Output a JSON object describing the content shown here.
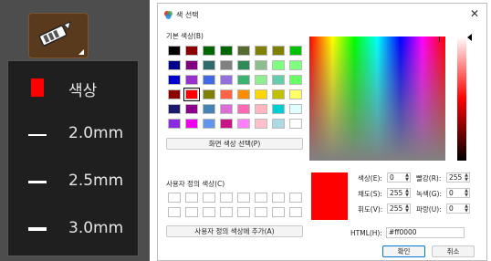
{
  "toolbar": {
    "tool_icon": "highlighter-pen-icon"
  },
  "menu": {
    "items": [
      {
        "label": "색상",
        "kind": "swatch",
        "color": "#ff0000"
      },
      {
        "label": "2.0mm",
        "kind": "line"
      },
      {
        "label": "2.5mm",
        "kind": "line"
      },
      {
        "label": "3.0mm",
        "kind": "line"
      }
    ]
  },
  "dialog": {
    "title": "색 선택",
    "basic_colors_label": "기본 색상(B)",
    "basic_colors": [
      "#000000",
      "#8b0000",
      "#006400",
      "#006400",
      "#556b2f",
      "#808000",
      "#808000",
      "#00c000",
      "#00008b",
      "#800080",
      "#2f6b6b",
      "#808080",
      "#2e8b57",
      "#8fbc8f",
      "#7fff7f",
      "#7fff7f",
      "#0000cd",
      "#9932cc",
      "#4169e1",
      "#9370db",
      "#3cb371",
      "#90ee90",
      "#66cdaa",
      "#66ff66",
      "#8b0000",
      "#ff0000",
      "#808000",
      "#ff6347",
      "#ff8c00",
      "#ffd700",
      "#c0c000",
      "#ffff66",
      "#191970",
      "#8b008b",
      "#4682b4",
      "#da70d6",
      "#ff69b4",
      "#ffb6c1",
      "#00ced1",
      "#e0ffff",
      "#8a2be2",
      "#ee00ee",
      "#6495ed",
      "#c71585",
      "#ff7fff",
      "#ffc0cb",
      "#add8e6",
      "#ffffff"
    ],
    "selected_basic_index": 25,
    "pick_screen_label": "화면 색상 선택(P)",
    "custom_colors_label": "사용자 정의 색상(C)",
    "add_custom_label": "사용자 정의 색상에 추가(A)",
    "fields": {
      "hue_label": "색상(E):",
      "hue": "0",
      "sat_label": "채도(S):",
      "sat": "255",
      "val_label": "휘도(V):",
      "val": "255",
      "red_label": "빨강(R):",
      "red": "255",
      "green_label": "녹색(G):",
      "green": "0",
      "blue_label": "파랑(U):",
      "blue": "0"
    },
    "html_label": "HTML(H):",
    "html_value": "#ff0000",
    "ok_label": "확인",
    "cancel_label": "취소",
    "preview_color": "#ff0000"
  }
}
